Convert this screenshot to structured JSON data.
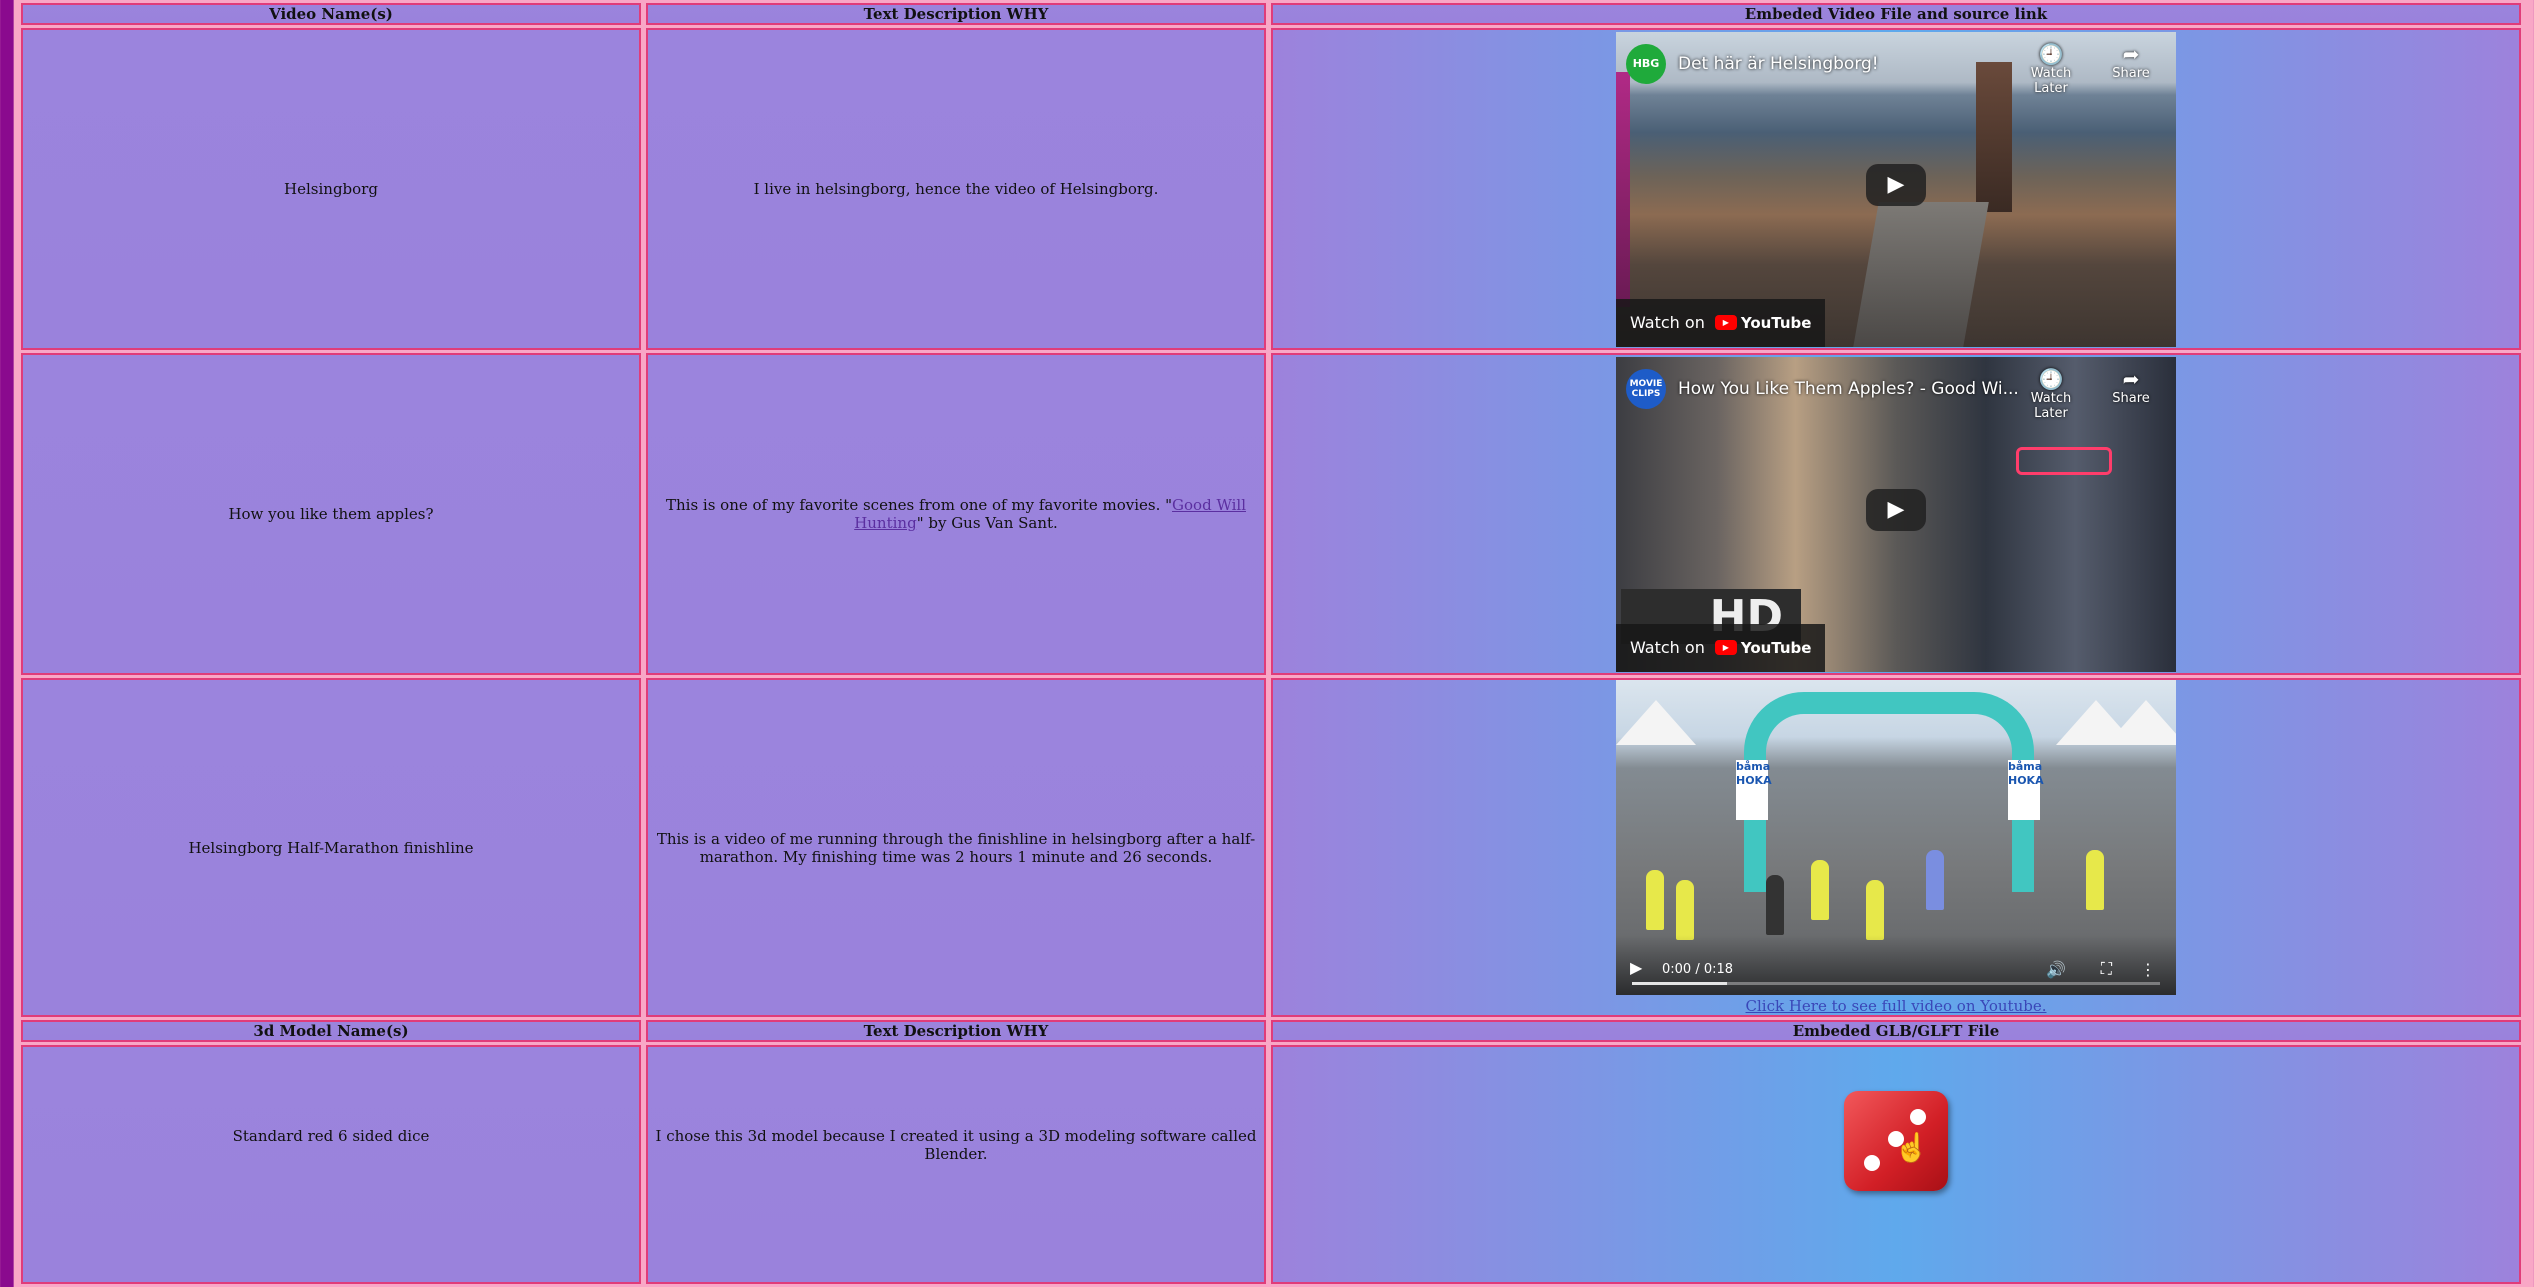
{
  "videos": {
    "headers": [
      "Video Name(s)",
      "Text Description WHY",
      "Embeded Video File and source link"
    ],
    "rows": [
      {
        "name": "Helsingborg",
        "description": "I live in helsingborg, hence the video of Helsingborg.",
        "player": {
          "title": "Det här är Helsingborg!",
          "channel_badge": "HBG",
          "watch_later": "Watch Later",
          "share": "Share",
          "watch_on": "Watch on",
          "youtube": "YouTube"
        }
      },
      {
        "name": "How you like them apples?",
        "description_before": "This is one of my favorite scenes from one of my favorite movies. \"",
        "link_text": "Good Will Hunting",
        "description_after": "\" by Gus Van Sant.",
        "player": {
          "title": "How You Like Them Apples? - Good Wi...",
          "channel_badge": "MOVIE CLIPS",
          "watch_later": "Watch Later",
          "share": "Share",
          "watch_on": "Watch on",
          "youtube": "YouTube",
          "overlay_text": "HD"
        }
      },
      {
        "name": "Helsingborg Half-Marathon finishline",
        "description": "This is a video of me running through the finishline in helsingborg after a half-marathon. My finishing time was 2 hours 1 minute and 26 seconds.",
        "video": {
          "time": "0:00 / 0:18",
          "progress": 0.18,
          "sign_left": "båma",
          "sign_right": "båma",
          "sponsor": "HOKA"
        },
        "source_link": "Click Here to see full video on Youtube."
      }
    ]
  },
  "models": {
    "headers": [
      "3d Model Name(s)",
      "Text Description WHY",
      "Embeded GLB/GLFT File"
    ],
    "rows": [
      {
        "name": "Standard red 6 sided dice",
        "description": "I chose this 3d model because I created it using a 3D modeling software called Blender."
      }
    ]
  },
  "colors": {
    "sidebar": "#8a0a8e",
    "cell_border": "#e03c7a",
    "cell_bg": "#9b84dd",
    "page_bg": "#f9a7c6"
  },
  "icons": {
    "clock": "clock-icon",
    "share": "share-icon",
    "play": "play-icon",
    "volume": "volume-icon",
    "fullscreen": "fullscreen-icon",
    "more": "more-vertical-icon"
  }
}
